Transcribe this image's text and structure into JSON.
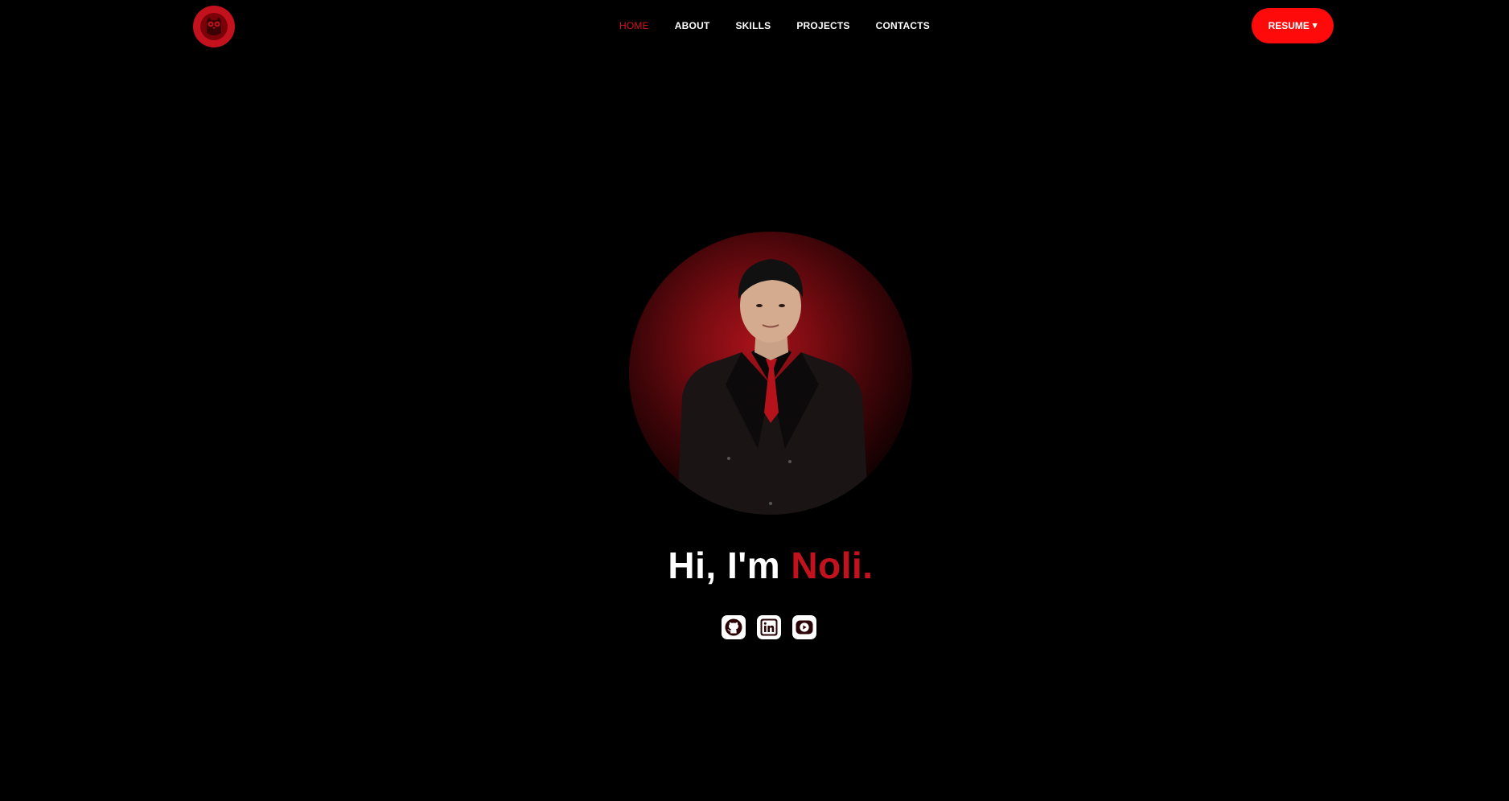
{
  "header": {
    "logo_icon": "owl-logo-icon",
    "nav": [
      {
        "label": "HOME",
        "active": true
      },
      {
        "label": "ABOUT",
        "active": false
      },
      {
        "label": "SKILLS",
        "active": false
      },
      {
        "label": "PROJECTS",
        "active": false
      },
      {
        "label": "CONTACTS",
        "active": false
      }
    ],
    "resume_label": "RESUME",
    "resume_caret": "▾"
  },
  "hero": {
    "greeting": "Hi, I'm ",
    "name": "Noli.",
    "portrait_icon": "profile-photo",
    "socials": [
      {
        "icon": "github-icon"
      },
      {
        "icon": "linkedin-icon"
      },
      {
        "icon": "youtube-icon"
      }
    ]
  },
  "colors": {
    "background": "#000000",
    "accent": "#c3121d",
    "button": "#ff0a0a",
    "text": "#ffffff"
  }
}
